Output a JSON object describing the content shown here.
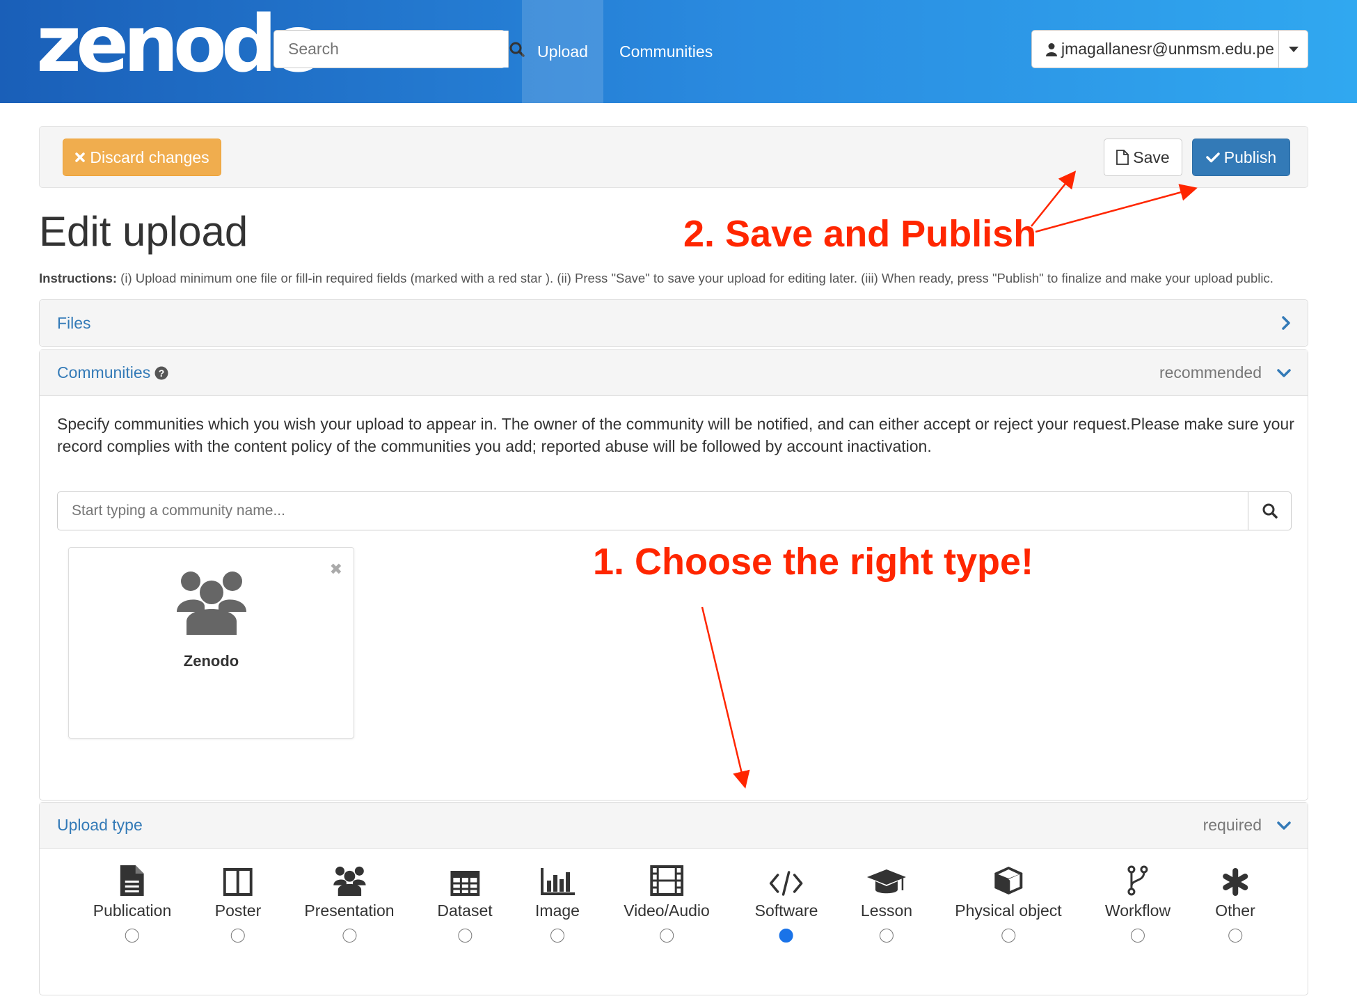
{
  "navbar": {
    "logo": "zenodo",
    "search_placeholder": "Search",
    "upload": "Upload",
    "communities": "Communities",
    "user": "jmagallanesr@unmsm.edu.pe"
  },
  "actions": {
    "discard": "Discard changes",
    "save": "Save",
    "publish": "Publish"
  },
  "page_title": "Edit upload",
  "instructions": {
    "label": "Instructions:",
    "text": " (i) Upload minimum one file or fill-in required fields (marked with a red star ). (ii) Press \"Save\" to save your upload for editing later. (iii) When ready, press \"Publish\" to finalize and make your upload public."
  },
  "files_panel": {
    "title": "Files"
  },
  "communities_panel": {
    "title": "Communities",
    "status": "recommended",
    "description": "Specify communities which you wish your upload to appear in. The owner of the community will be notified, and can either accept or reject your request.Please make sure your record complies with the content policy of the communities you add; reported abuse will be followed by account inactivation.",
    "search_placeholder": "Start typing a community name...",
    "card_name": "Zenodo"
  },
  "upload_type_panel": {
    "title": "Upload type",
    "status": "required",
    "selected": "Software",
    "types": [
      {
        "label": "Publication",
        "icon": "file-text-icon"
      },
      {
        "label": "Poster",
        "icon": "columns-icon"
      },
      {
        "label": "Presentation",
        "icon": "group-icon"
      },
      {
        "label": "Dataset",
        "icon": "table-icon"
      },
      {
        "label": "Image",
        "icon": "bar-chart-icon"
      },
      {
        "label": "Video/Audio",
        "icon": "film-icon"
      },
      {
        "label": "Software",
        "icon": "code-icon"
      },
      {
        "label": "Lesson",
        "icon": "graduation-cap-icon"
      },
      {
        "label": "Physical object",
        "icon": "cube-icon"
      },
      {
        "label": "Workflow",
        "icon": "code-fork-icon"
      },
      {
        "label": "Other",
        "icon": "asterisk-icon"
      }
    ]
  },
  "annotations": {
    "step1": "1. Choose the right type!",
    "step2": "2. Save and Publish",
    "color": "#ff2600"
  }
}
